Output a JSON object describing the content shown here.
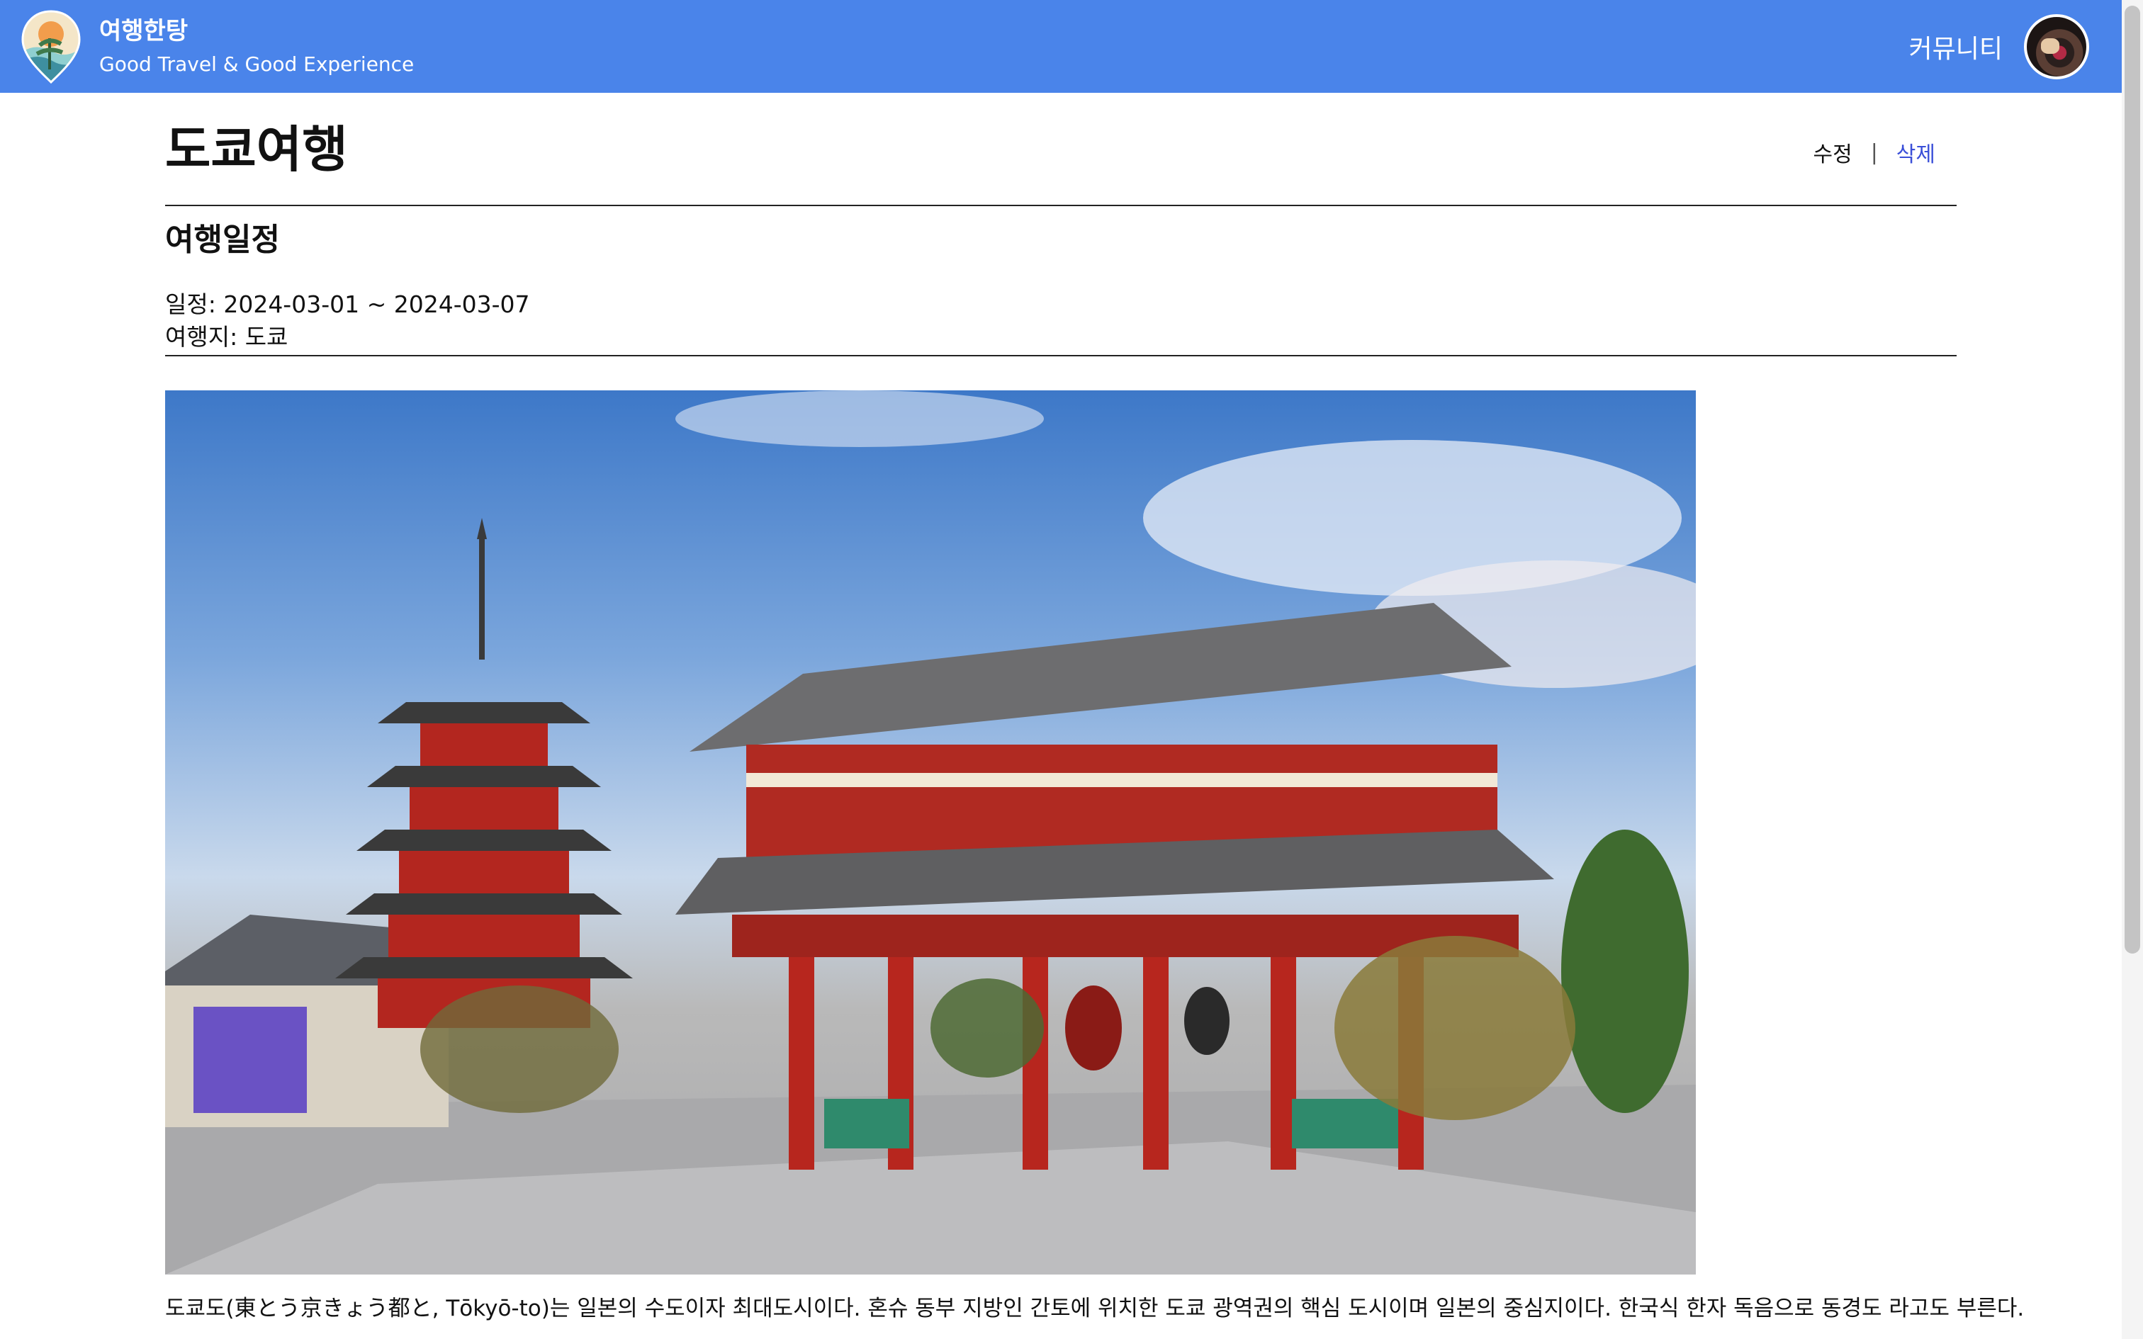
{
  "header": {
    "brand_title": "여행한탕",
    "brand_subtitle": "Good Travel & Good Experience",
    "community_label": "커뮤니티",
    "colors": {
      "bar": "#4a84ea",
      "text": "#ffffff"
    }
  },
  "post": {
    "title": "도쿄여행",
    "edit_label": "수정",
    "separator": "|",
    "delete_label": "삭제",
    "section_title": "여행일정",
    "schedule_label": "일정: 2024-03-01 ~ 2024-03-07",
    "destination_label": "여행지: 도쿄",
    "description": "도쿄도(東とう京きょう都と, Tōkyō-to)는 일본의 수도이자 최대도시이다. 혼슈 동부 지방인 간토에 위치한 도쿄 광역권의 핵심 도시이며 일본의 중심지이다. 한국식 한자 독음으로 동경도 라고도 부른다."
  },
  "icons": {
    "logo": "travel-logo-icon",
    "avatar": "user-avatar"
  },
  "colors": {
    "delete_link": "#3a4fd8",
    "divider": "#222222"
  }
}
